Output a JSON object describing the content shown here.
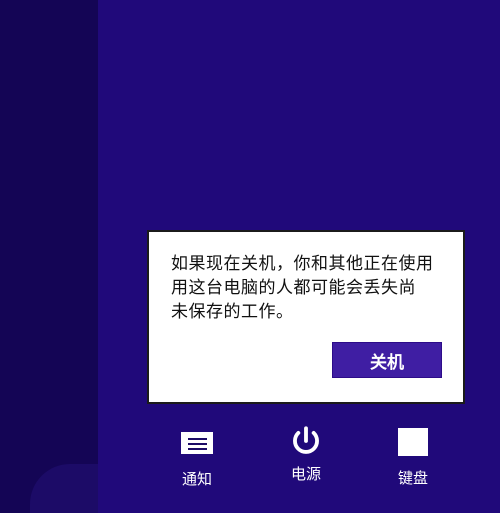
{
  "dialog": {
    "message_lines": [
      "如果现在关机，你和其他正在使用",
      "用这台电脑的人都可能会丢失尚",
      "未保存的工作。"
    ],
    "button_label": "关机"
  },
  "taskbar": {
    "items": [
      {
        "label": "通知",
        "icon": "notification-icon"
      },
      {
        "label": "电源",
        "icon": "power-icon"
      },
      {
        "label": "键盘",
        "icon": "keyboard-icon"
      }
    ]
  },
  "colors": {
    "background": "#1c0b66",
    "dialog_button": "#3f1ea3",
    "dialog_background": "#ffffff"
  }
}
